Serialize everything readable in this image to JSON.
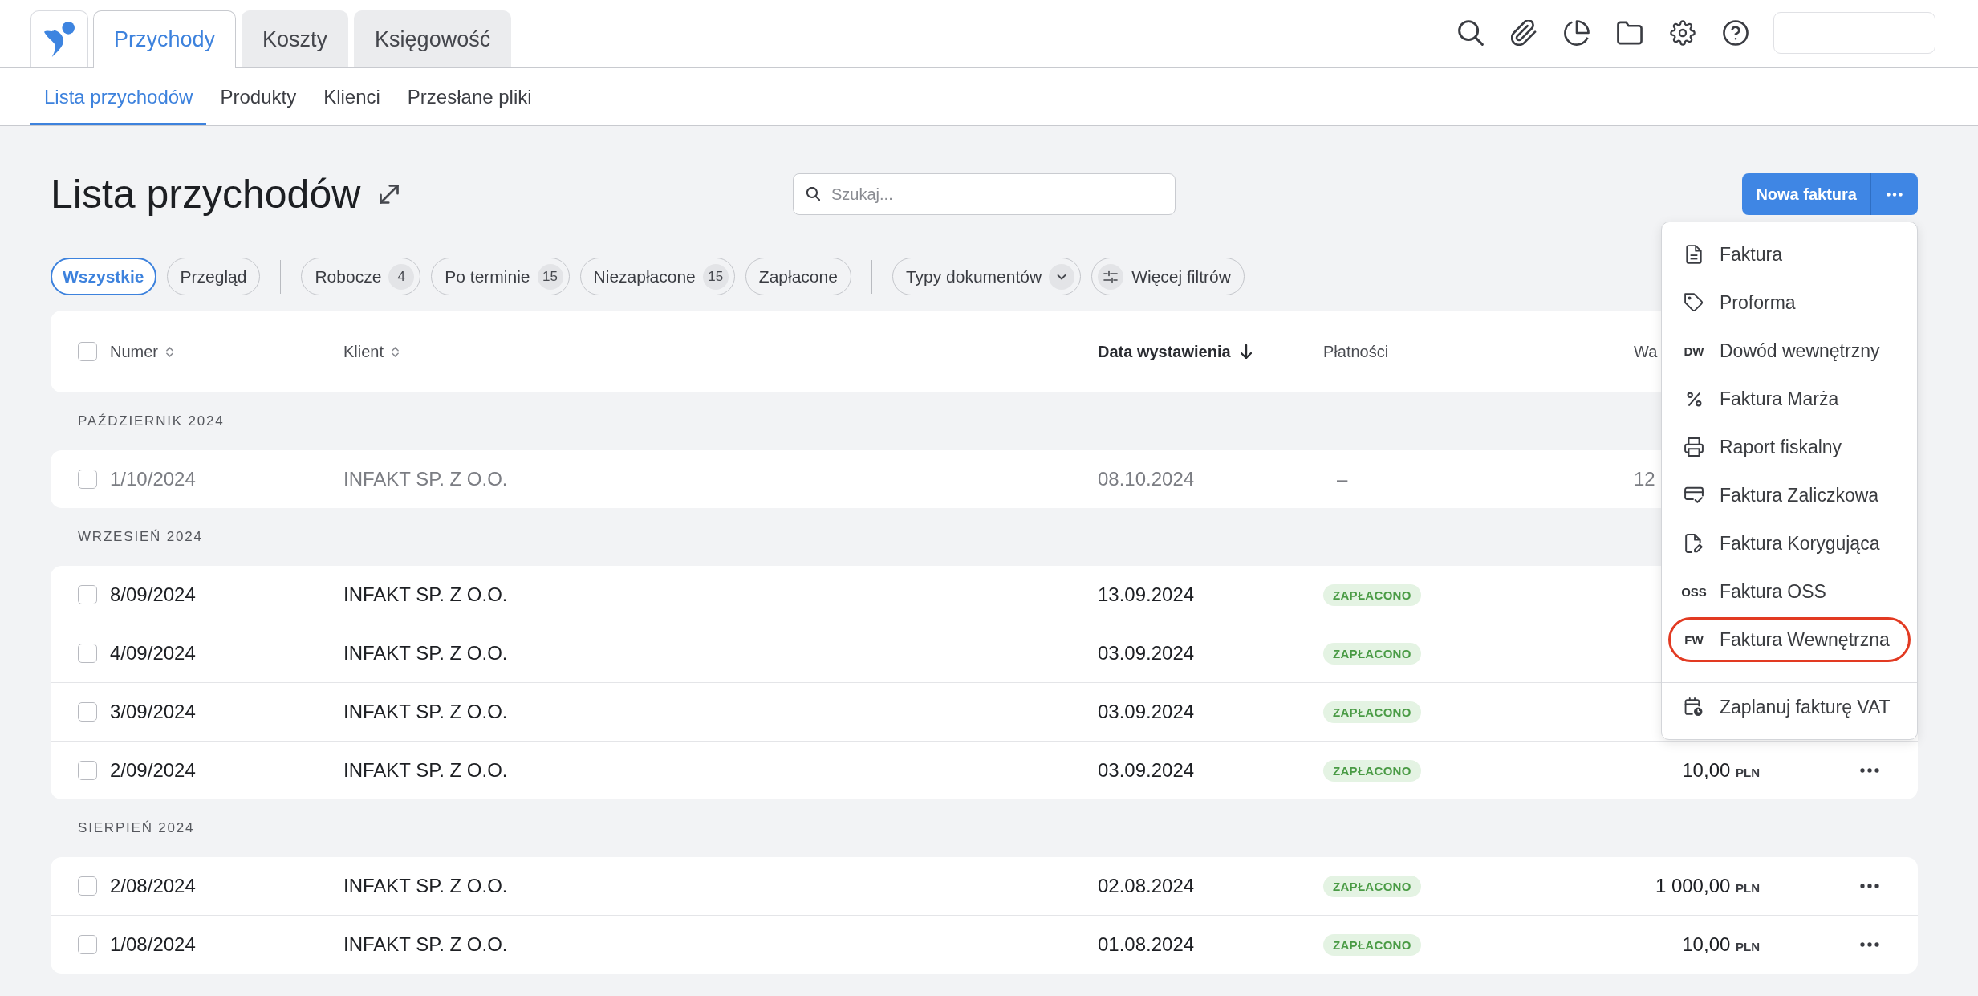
{
  "tabs": [
    {
      "label": "Przychody",
      "selected": true
    },
    {
      "label": "Koszty",
      "selected": false
    },
    {
      "label": "Księgowość",
      "selected": false
    }
  ],
  "subnav": [
    {
      "label": "Lista przychodów",
      "selected": true
    },
    {
      "label": "Produkty",
      "selected": false
    },
    {
      "label": "Klienci",
      "selected": false
    },
    {
      "label": "Przesłane pliki",
      "selected": false
    }
  ],
  "page": {
    "title": "Lista przychodów",
    "search": {
      "placeholder": "Szukaj..."
    },
    "primary_button": "Nowa faktura"
  },
  "filters": [
    {
      "chips": [
        {
          "kind": "status",
          "label": "Wszystkie",
          "selected": true
        },
        {
          "kind": "status",
          "label": "Przegląd",
          "selected": false
        }
      ]
    },
    {
      "chips": [
        {
          "kind": "status",
          "label": "Robocze",
          "count": "4",
          "selected": false
        },
        {
          "kind": "status",
          "label": "Po terminie",
          "count": "15",
          "selected": false
        },
        {
          "kind": "status",
          "label": "Niezapłacone",
          "count": "15",
          "selected": false
        },
        {
          "kind": "status",
          "label": "Zapłacone",
          "selected": false
        }
      ]
    },
    {
      "chips": [
        {
          "kind": "dropdown",
          "label": "Typy dokumentów",
          "selected": false
        },
        {
          "kind": "more",
          "label": "Więcej filtrów",
          "selected": false
        }
      ]
    }
  ],
  "table": {
    "select_all": {
      "checked": false
    },
    "columns": [
      {
        "label": "Numer",
        "sortable": true,
        "sorted": false
      },
      {
        "label": "Klient",
        "sortable": true,
        "sorted": false
      },
      {
        "label": "Data wystawienia",
        "sortable": false,
        "sorted": true
      },
      {
        "label": "Płatności",
        "sortable": false,
        "sorted": false
      },
      {
        "label": "Wa",
        "sortable": false,
        "sorted": false
      }
    ],
    "groups": [
      {
        "label": "PAŹDZIERNIK 2024",
        "rows": [
          {
            "number": "1/10/2024",
            "client": "INFAKT SP. Z O.O.",
            "date": "08.10.2024",
            "payment": {
              "kind": "text",
              "text": "–"
            },
            "amount": "12",
            "draft": true,
            "checked": false
          }
        ]
      },
      {
        "label": "WRZESIEŃ 2024",
        "rows": [
          {
            "number": "8/09/2024",
            "client": "INFAKT SP. Z O.O.",
            "date": "13.09.2024",
            "payment": {
              "kind": "badge",
              "text": "ZAPŁACONO"
            },
            "draft": false,
            "checked": false
          },
          {
            "number": "4/09/2024",
            "client": "INFAKT SP. Z O.O.",
            "date": "03.09.2024",
            "payment": {
              "kind": "badge",
              "text": "ZAPŁACONO"
            },
            "draft": false,
            "checked": false
          },
          {
            "number": "3/09/2024",
            "client": "INFAKT SP. Z O.O.",
            "date": "03.09.2024",
            "payment": {
              "kind": "badge",
              "text": "ZAPŁACONO"
            },
            "draft": false,
            "checked": false
          },
          {
            "number": "2/09/2024",
            "client": "INFAKT SP. Z O.O.",
            "date": "03.09.2024",
            "payment": {
              "kind": "badge",
              "text": "ZAPŁACONO"
            },
            "amount": "10,00",
            "currency": "PLN",
            "draft": false,
            "checked": false,
            "more": true
          }
        ]
      },
      {
        "label": "SIERPIEŃ 2024",
        "rows": [
          {
            "number": "2/08/2024",
            "client": "INFAKT SP. Z O.O.",
            "date": "02.08.2024",
            "payment": {
              "kind": "badge",
              "text": "ZAPŁACONO"
            },
            "amount": "1 000,00",
            "currency": "PLN",
            "draft": false,
            "checked": false,
            "more": true
          },
          {
            "number": "1/08/2024",
            "client": "INFAKT SP. Z O.O.",
            "date": "01.08.2024",
            "payment": {
              "kind": "badge",
              "text": "ZAPŁACONO"
            },
            "amount": "10,00",
            "currency": "PLN",
            "draft": false,
            "checked": false,
            "more": true
          }
        ]
      }
    ]
  },
  "menu": {
    "sections": [
      {
        "items": [
          {
            "kind": "document",
            "label": "Faktura",
            "highlighted": false
          },
          {
            "kind": "tag",
            "label": "Proforma",
            "highlighted": false
          },
          {
            "kind": "abbr",
            "abbr": "DW",
            "label": "Dowód wewnętrzny",
            "highlighted": false
          },
          {
            "kind": "percent",
            "label": "Faktura Marża",
            "highlighted": false
          },
          {
            "kind": "printer",
            "label": "Raport fiskalny",
            "highlighted": false
          },
          {
            "kind": "card",
            "label": "Faktura Zaliczkowa",
            "highlighted": false
          },
          {
            "kind": "document-edit",
            "label": "Faktura Korygująca",
            "highlighted": false
          },
          {
            "kind": "abbr",
            "abbr": "OSS",
            "label": "Faktura OSS",
            "highlighted": false
          },
          {
            "kind": "abbr",
            "abbr": "FW",
            "label": "Faktura Wewnętrzna",
            "highlighted": true
          }
        ]
      },
      {
        "items": [
          {
            "kind": "calendar",
            "label": "Zaplanuj fakturę VAT",
            "highlighted": false
          }
        ]
      }
    ]
  }
}
